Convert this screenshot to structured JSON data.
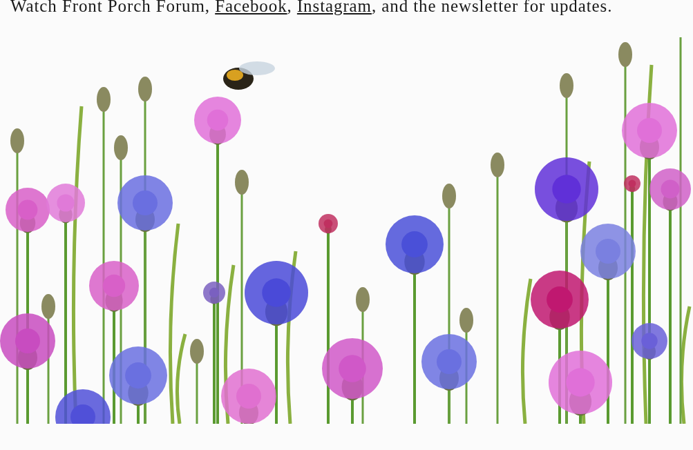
{
  "paragraph": {
    "parts": [
      {
        "kind": "text",
        "text": "Watch Front Porch Forum, "
      },
      {
        "kind": "link",
        "text": "Facebook"
      },
      {
        "kind": "text",
        "text": ", "
      },
      {
        "kind": "link",
        "text": "Instagram"
      },
      {
        "kind": "text",
        "text": ", and the newsletter for updates."
      }
    ]
  }
}
